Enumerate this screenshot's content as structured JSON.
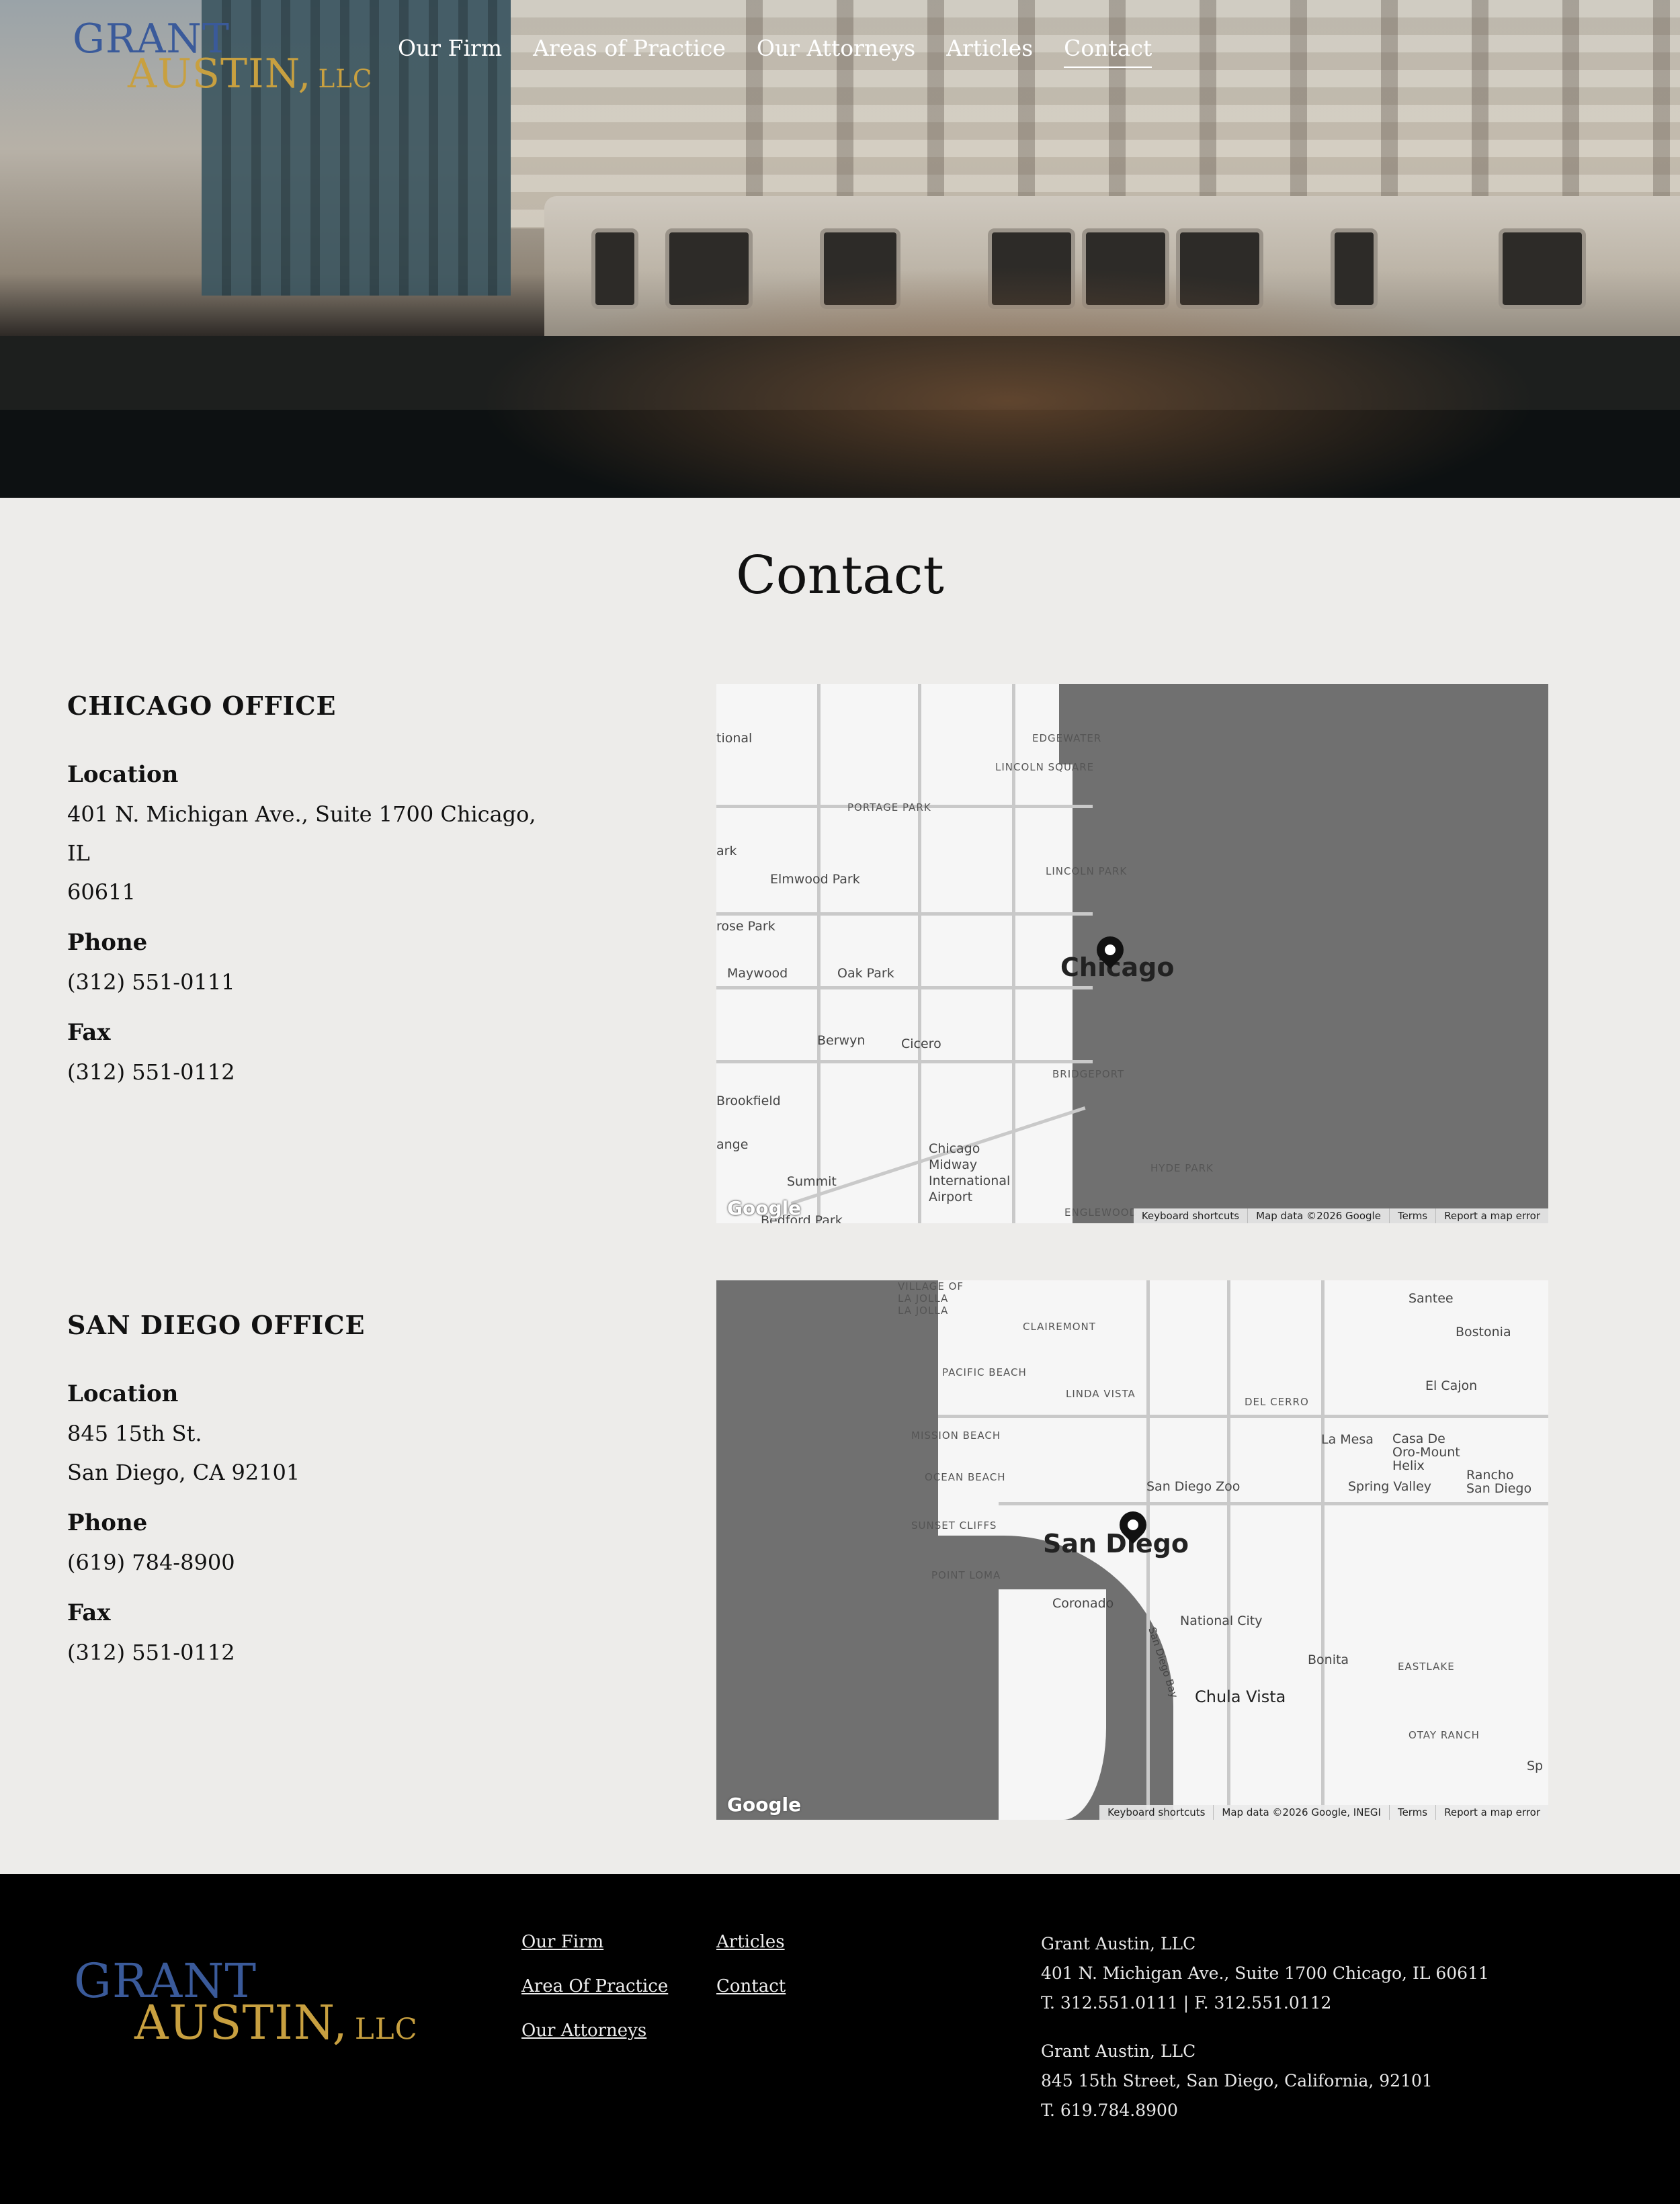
{
  "brand": {
    "line1": "GRANT",
    "line2": "AUSTIN,",
    "suffix": "LLC",
    "color_blue": "#3a5a9a",
    "color_gold": "#c8a040"
  },
  "nav": {
    "items": [
      {
        "label": "Our Firm"
      },
      {
        "label": "Areas of Practice"
      },
      {
        "label": "Our Attorneys"
      },
      {
        "label": "Articles"
      },
      {
        "label": "Contact",
        "active": true
      }
    ]
  },
  "page": {
    "title": "Contact"
  },
  "offices": {
    "chicago": {
      "heading": "CHICAGO OFFICE",
      "location_label": "Location",
      "location_line1": "401 N. Michigan Ave., Suite 1700 Chicago, IL",
      "location_line2": "60611",
      "phone_label": "Phone",
      "phone": "(312) 551-0111",
      "fax_label": "Fax",
      "fax": "(312) 551-0112"
    },
    "sandiego": {
      "heading": "SAN DIEGO OFFICE",
      "location_label": "Location",
      "location_line1": "845 15th St.",
      "location_line2": "San Diego, CA 92101",
      "phone_label": "Phone",
      "phone": "(619) 784-8900",
      "fax_label": "Fax",
      "fax": "(312) 551-0112"
    }
  },
  "maps": {
    "chicago": {
      "city": "Chicago",
      "labels": [
        "EDGEWATER",
        "LINCOLN SQUARE",
        "PORTAGE PARK",
        "LINCOLN PARK",
        "Elmwood Park",
        "rose Park",
        "Maywood",
        "Oak Park",
        "Berwyn",
        "Cicero",
        "BRIDGEPORT",
        "Brookfield",
        "ange",
        "Summit",
        "Chicago Midway International Airport",
        "HYDE PARK",
        "ENGLEWOOD",
        "Bedford Park",
        "tional",
        "ark"
      ],
      "google": "Google",
      "attrib": [
        "Keyboard shortcuts",
        "Map data ©2026 Google",
        "Terms",
        "Report a map error"
      ]
    },
    "sandiego": {
      "city": "San Diego",
      "labels": [
        "VILLAGE OF LA JOLLA",
        "LA JOLLA",
        "CLAIREMONT",
        "Santee",
        "Bostonia",
        "PACIFIC BEACH",
        "LINDA VISTA",
        "DEL CERRO",
        "El Cajon",
        "MISSION BEACH",
        "La Mesa",
        "Casa De Oro-Mount Helix",
        "OCEAN BEACH",
        "San Diego Zoo",
        "Spring Valley",
        "Rancho San Diego",
        "SUNSET CLIFFS",
        "POINT LOMA",
        "Coronado",
        "National City",
        "Bonita",
        "EASTLAKE",
        "San Diego Bay",
        "Chula Vista",
        "OTAY RANCH",
        "Sp"
      ],
      "google": "Google",
      "attrib": [
        "Keyboard shortcuts",
        "Map data ©2026 Google, INEGI",
        "Terms",
        "Report a map error"
      ]
    }
  },
  "footer": {
    "links_col1": [
      "Our Firm",
      "Area Of Practice",
      "Our Attorneys"
    ],
    "links_col2": [
      "Articles",
      "Contact"
    ],
    "address1": {
      "name": "Grant Austin, LLC",
      "street": "401 N. Michigan Ave., Suite 1700 Chicago, IL 60611",
      "phones": "T. 312.551.0111 | F. 312.551.0112"
    },
    "address2": {
      "name": "Grant Austin, LLC",
      "street": "845 15th Street, San Diego, California, 92101",
      "phones": "T. 619.784.8900"
    }
  }
}
